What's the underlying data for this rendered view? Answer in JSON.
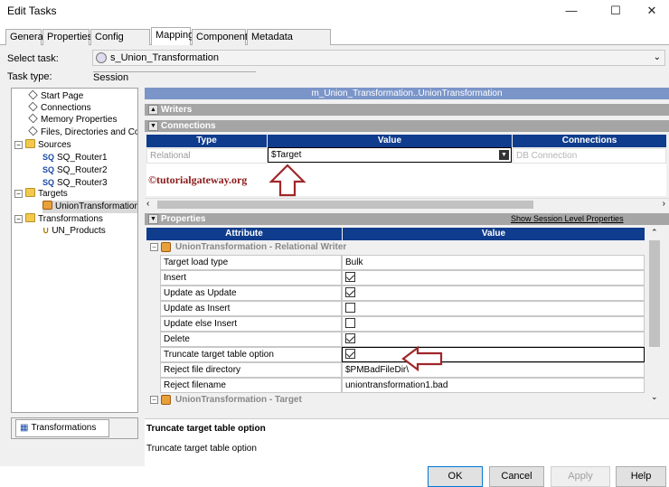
{
  "window": {
    "title": "Edit Tasks"
  },
  "tabs": [
    "General",
    "Properties",
    "Config Object",
    "Mapping",
    "Components",
    "Metadata Extensions"
  ],
  "select_task": {
    "label": "Select task:",
    "value": "s_Union_Transformation"
  },
  "task_type": {
    "label": "Task type:",
    "value": "Session"
  },
  "tree": {
    "items": [
      "Start Page",
      "Connections",
      "Memory Properties",
      "Files, Directories and Com",
      "Sources",
      "SQ_Router1",
      "SQ_Router2",
      "SQ_Router3",
      "Targets",
      "UnionTransformation",
      "Transformations",
      "UN_Products"
    ],
    "bottom_tab": "Transformations"
  },
  "mapping_header": "m_Union_Transformation..UnionTransformation",
  "writers_label": "Writers",
  "connections": {
    "label": "Connections",
    "columns": [
      "Type",
      "Value",
      "Connections"
    ],
    "row": {
      "type": "Relational",
      "value": "$Target",
      "connection": "DB Connection"
    }
  },
  "watermark": "©tutorialgateway.org",
  "properties": {
    "label": "Properties",
    "link": "Show Session Level Properties",
    "columns": [
      "Attribute",
      "Value"
    ],
    "group1": "UnionTransformation - Relational Writer",
    "rows": [
      {
        "attr": "Target load type",
        "value": "Bulk"
      },
      {
        "attr": "Insert",
        "checked": true
      },
      {
        "attr": "Update as Update",
        "checked": true
      },
      {
        "attr": "Update as Insert",
        "checked": false
      },
      {
        "attr": "Update else Insert",
        "checked": false
      },
      {
        "attr": "Delete",
        "checked": true
      },
      {
        "attr": "Truncate target table option",
        "checked": true
      },
      {
        "attr": "Reject file directory",
        "value": "$PMBadFileDir\\"
      },
      {
        "attr": "Reject filename",
        "value": "uniontransformation1.bad"
      }
    ],
    "group2": "UnionTransformation - Target"
  },
  "description": {
    "title": "Truncate target table option",
    "text": "Truncate target table option"
  },
  "buttons": {
    "ok": "OK",
    "cancel": "Cancel",
    "apply": "Apply",
    "help": "Help"
  },
  "colors": {
    "accent": "#0f3c8c",
    "mapping_header": "#7b95c9",
    "arrow": "#a0262a"
  }
}
